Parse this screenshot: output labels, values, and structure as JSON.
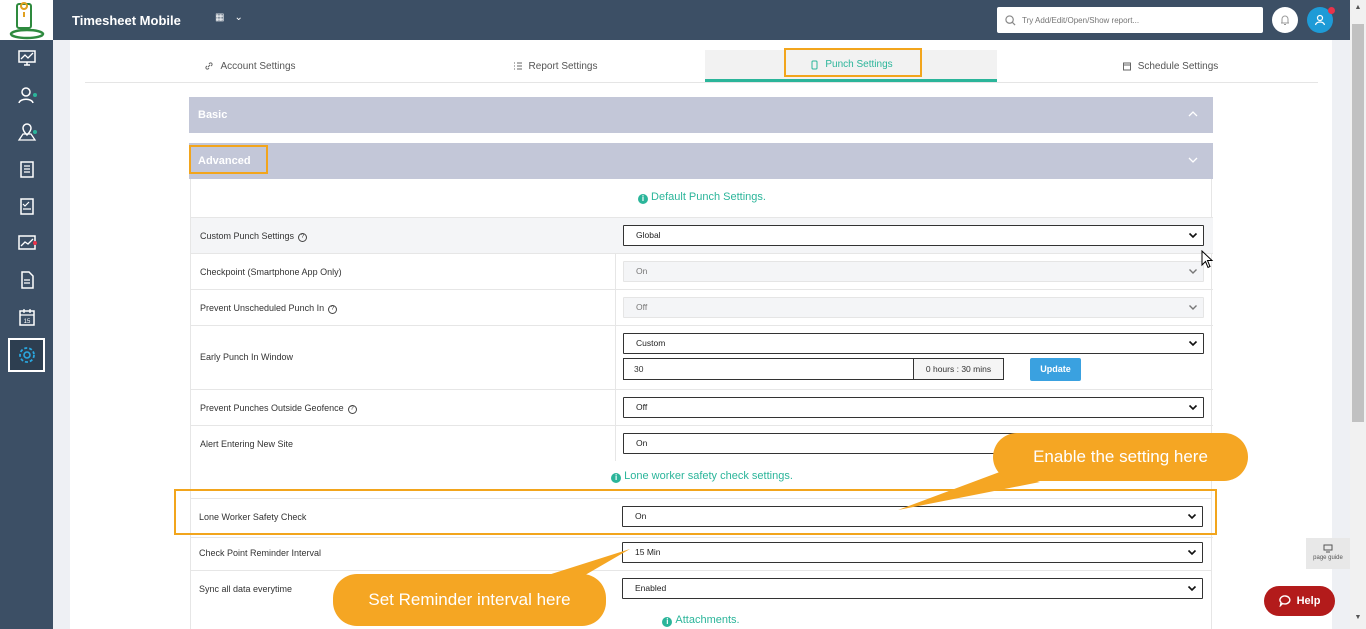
{
  "header": {
    "app_title": "Timesheet Mobile",
    "search_placeholder": "Try Add/Edit/Open/Show report..."
  },
  "sidebar": {
    "items": [
      {
        "icon": "dashboard-icon",
        "dot_color": ""
      },
      {
        "icon": "users-icon",
        "dot_color": "#2bb59a"
      },
      {
        "icon": "map-pin-icon",
        "dot_color": "#2bb59a"
      },
      {
        "icon": "clipboard-icon",
        "dot_color": ""
      },
      {
        "icon": "checklist-icon",
        "dot_color": ""
      },
      {
        "icon": "chart-icon",
        "dot_color": "#e8334a"
      },
      {
        "icon": "document-icon",
        "dot_color": ""
      },
      {
        "icon": "calendar-icon",
        "dot_color": ""
      },
      {
        "icon": "settings-icon",
        "dot_color": "",
        "active": true
      }
    ],
    "calendar_day": "15"
  },
  "tabs": [
    {
      "label": "Account Settings",
      "icon": "link-icon"
    },
    {
      "label": "Report Settings",
      "icon": "list-icon"
    },
    {
      "label": "Punch Settings",
      "icon": "phone-icon",
      "active": true
    },
    {
      "label": "Schedule Settings",
      "icon": "calendar-icon"
    }
  ],
  "accordions": {
    "basic": "Basic",
    "advanced": "Advanced"
  },
  "sections": {
    "default_punch": "Default Punch Settings.",
    "lone_worker": "Lone worker safety check settings.",
    "attachments": "Attachments."
  },
  "rows": {
    "custom_punch": {
      "label": "Custom Punch Settings",
      "value": "Global"
    },
    "checkpoint": {
      "label": "Checkpoint (Smartphone App Only)",
      "value": "On"
    },
    "prevent_unscheduled": {
      "label": "Prevent Unscheduled Punch In",
      "value": "Off"
    },
    "early_punch": {
      "label": "Early Punch In Window",
      "value": "Custom",
      "minutes": "30",
      "addon": "0 hours : 30 mins",
      "button": "Update"
    },
    "prevent_geofence": {
      "label": "Prevent Punches Outside Geofence",
      "value": "Off"
    },
    "alert_new_site": {
      "label": "Alert Entering New Site",
      "value": "On"
    },
    "lone_worker": {
      "label": "Lone Worker Safety Check",
      "value": "On"
    },
    "checkpoint_reminder": {
      "label": "Check Point Reminder Interval",
      "value": "15 Min"
    },
    "sync_data": {
      "label": "Sync all data everytime",
      "value": "Enabled"
    }
  },
  "callouts": {
    "enable": "Enable the setting here",
    "reminder": "Set Reminder interval here"
  },
  "page_guide": "page guide",
  "help": "Help",
  "colors": {
    "sidebar": "#3c4f65",
    "accent": "#2bb59a",
    "highlight": "#f2a51c",
    "callout": "#f5a623",
    "help": "#b31b1b"
  }
}
